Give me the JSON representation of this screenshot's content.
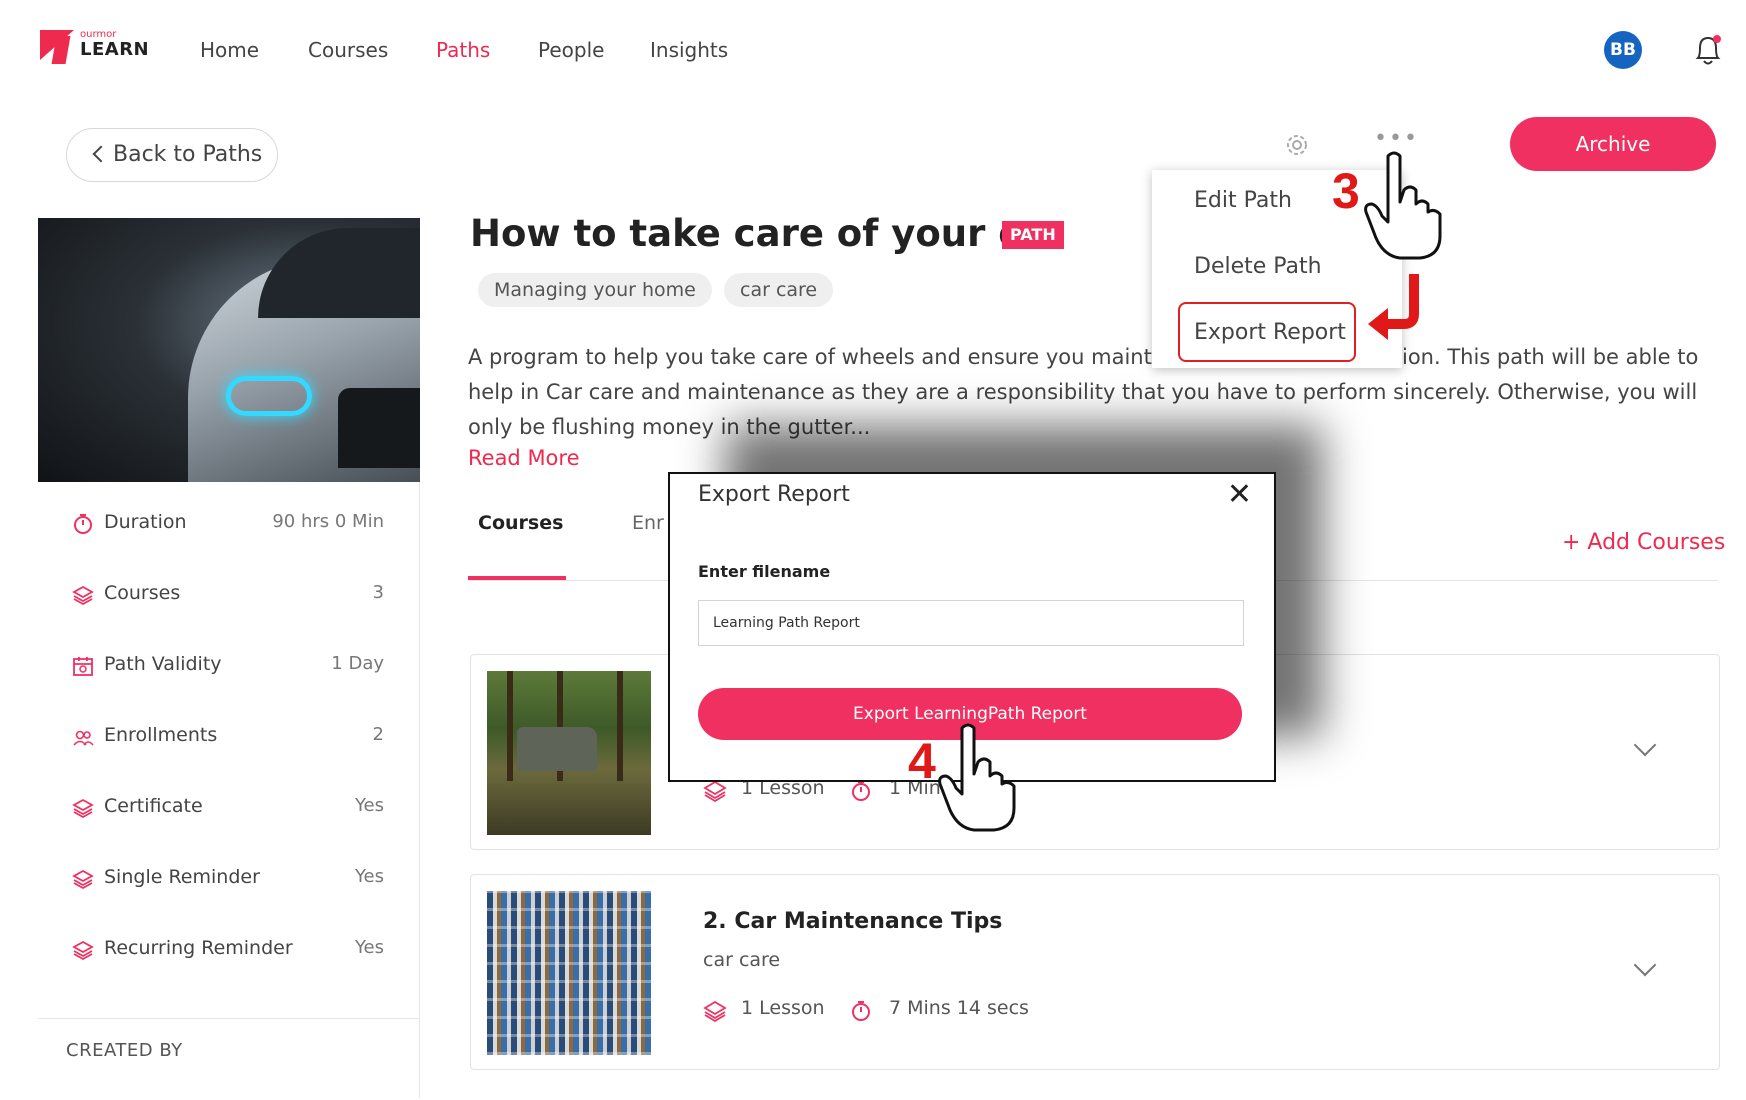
{
  "header": {
    "logo_small": "ourmor",
    "logo_big": "LEARN",
    "nav": [
      "Home",
      "Courses",
      "Paths",
      "People",
      "Insights"
    ],
    "active_nav": "Paths",
    "avatar_initials": "BB"
  },
  "toolbar": {
    "back_label": "Back to Paths",
    "archive_label": "Archive",
    "more_label": "•••"
  },
  "menu": {
    "items": [
      "Edit Path",
      "Delete Path",
      "Export Report"
    ]
  },
  "path": {
    "title": "How to take care of your car",
    "badge": "PATH",
    "tags": [
      "Managing your home",
      "car care"
    ],
    "description_lines": [
      "A program to help you take care of wheels and ensure you maint",
      "ion. This path will be able to",
      "help in Car care and maintenance as they are a responsibility that you have to perform sincerely. Otherwise, you will",
      "only be flushing money in the gutter..."
    ],
    "read_more": "Read More"
  },
  "stats": [
    {
      "label": "Duration",
      "value": "90 hrs 0 Min"
    },
    {
      "label": "Courses",
      "value": "3"
    },
    {
      "label": "Path Validity",
      "value": "1 Day"
    },
    {
      "label": "Enrollments",
      "value": "2"
    },
    {
      "label": "Certificate",
      "value": "Yes"
    },
    {
      "label": "Single Reminder",
      "value": "Yes"
    },
    {
      "label": "Recurring Reminder",
      "value": "Yes"
    }
  ],
  "created_by_label": "CREATED BY",
  "tabs": {
    "courses": "Courses",
    "enrollments_partial": "Enr",
    "add_courses": "+ Add Courses"
  },
  "courses": [
    {
      "lessons": "1 Lesson",
      "duration": "1 Min"
    },
    {
      "title": "2. Car Maintenance Tips",
      "tag": "car care",
      "lessons": "1 Lesson",
      "duration": "7 Mins 14 secs"
    }
  ],
  "modal": {
    "title": "Export Report",
    "close": "✕",
    "label": "Enter filename",
    "input_value": "Learning Path Report",
    "button": "Export LearningPath Report"
  },
  "annotations": {
    "step3": "3",
    "step4": "4"
  },
  "colors": {
    "accent": "#f03060",
    "annotation_red": "#e01818",
    "avatar_blue": "#1565c0"
  }
}
